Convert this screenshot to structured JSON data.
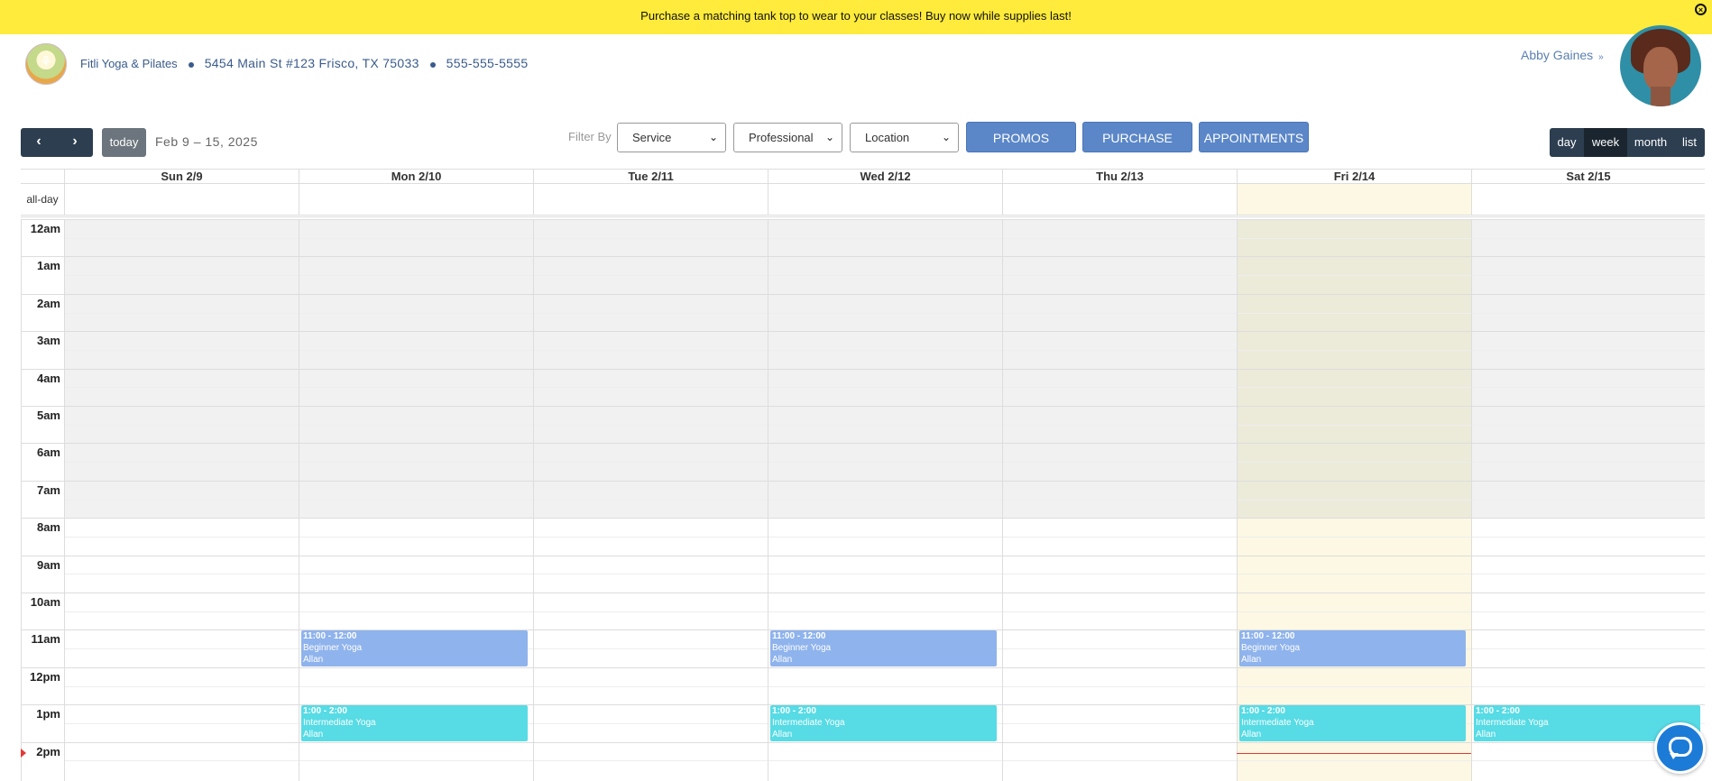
{
  "banner": {
    "text": "Purchase a matching tank top to wear to your classes! Buy now while supplies last!",
    "close_icon": "close-circle-icon"
  },
  "header": {
    "business_name": "Fitli Yoga & Pilates",
    "address": "5454 Main St #123 Frisco, TX 75033",
    "phone": "555-555-5555",
    "user_name": "Abby Gaines",
    "user_chevron": "»"
  },
  "toolbar": {
    "prev": "‹",
    "next": "›",
    "today": "today",
    "date_range": "Feb 9 – 15, 2025",
    "filter_by": "Filter By",
    "filters": [
      {
        "value": "Service"
      },
      {
        "value": "Professional"
      },
      {
        "value": "Location"
      }
    ],
    "buttons": [
      "PROMOS",
      "PURCHASE",
      "APPOINTMENTS"
    ],
    "views": [
      "day",
      "week",
      "month",
      "list"
    ],
    "active_view": "week"
  },
  "calendar": {
    "all_day_label": "all-day",
    "days": [
      "Sun 2/9",
      "Mon 2/10",
      "Tue 2/11",
      "Wed 2/12",
      "Thu 2/13",
      "Fri 2/14",
      "Sat 2/15"
    ],
    "today_index": 5,
    "times": [
      "12am",
      "1am",
      "2am",
      "3am",
      "4am",
      "5am",
      "6am",
      "7am",
      "8am",
      "9am",
      "10am",
      "11am",
      "12pm",
      "1pm",
      "2pm"
    ],
    "events": [
      {
        "day": 1,
        "start": 11,
        "end": 12,
        "time": "11:00 - 12:00",
        "title": "Beginner Yoga",
        "instructor": "Allan",
        "color": "#8fb3ec"
      },
      {
        "day": 3,
        "start": 11,
        "end": 12,
        "time": "11:00 - 12:00",
        "title": "Beginner Yoga",
        "instructor": "Allan",
        "color": "#8fb3ec"
      },
      {
        "day": 5,
        "start": 11,
        "end": 12,
        "time": "11:00 - 12:00",
        "title": "Beginner Yoga",
        "instructor": "Allan",
        "color": "#8fb3ec"
      },
      {
        "day": 1,
        "start": 13,
        "end": 14,
        "time": "1:00 - 2:00",
        "title": "Intermediate Yoga",
        "instructor": "Allan",
        "color": "#57dbe5"
      },
      {
        "day": 3,
        "start": 13,
        "end": 14,
        "time": "1:00 - 2:00",
        "title": "Intermediate Yoga",
        "instructor": "Allan",
        "color": "#57dbe5"
      },
      {
        "day": 5,
        "start": 13,
        "end": 14,
        "time": "1:00 - 2:00",
        "title": "Intermediate Yoga",
        "instructor": "Allan",
        "color": "#57dbe5"
      },
      {
        "day": 6,
        "start": 13,
        "end": 14,
        "time": "1:00 - 2:00",
        "title": "Intermediate Yoga",
        "instructor": "Allan",
        "color": "#57dbe5"
      }
    ]
  },
  "colors": {
    "banner": "#ffeb3b",
    "nav_dark": "#2c3e50",
    "primary_button": "#5b87c8",
    "today_highlight": "#fcf8e3",
    "now_indicator": "#e53935"
  },
  "chat": {
    "icon": "chat-bubble-icon"
  }
}
